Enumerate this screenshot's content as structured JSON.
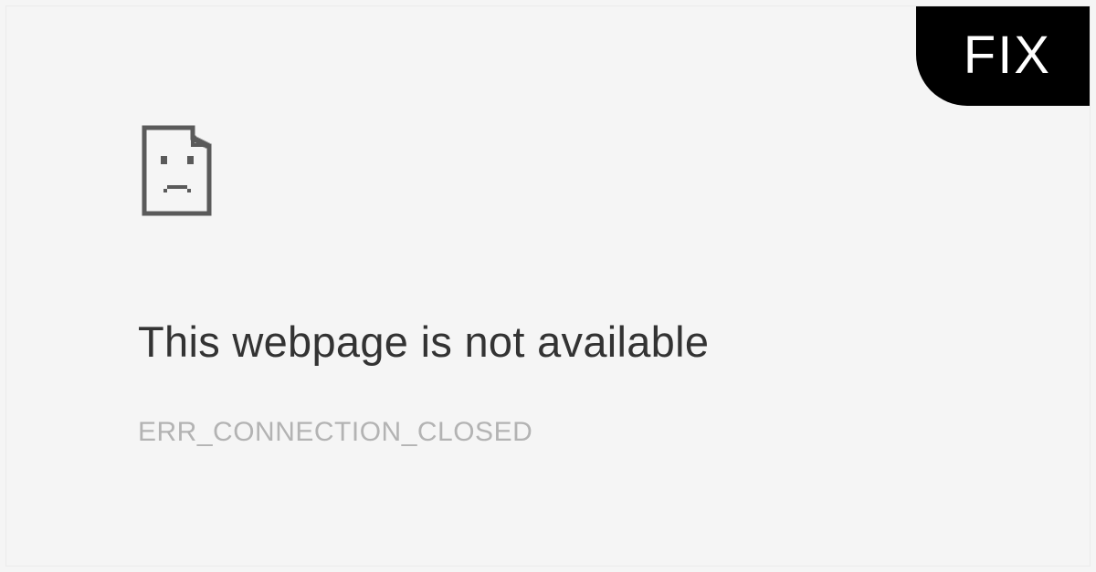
{
  "badge": {
    "label": "FIX"
  },
  "error": {
    "heading": "This webpage is not available",
    "code": "ERR_CONNECTION_CLOSED"
  }
}
